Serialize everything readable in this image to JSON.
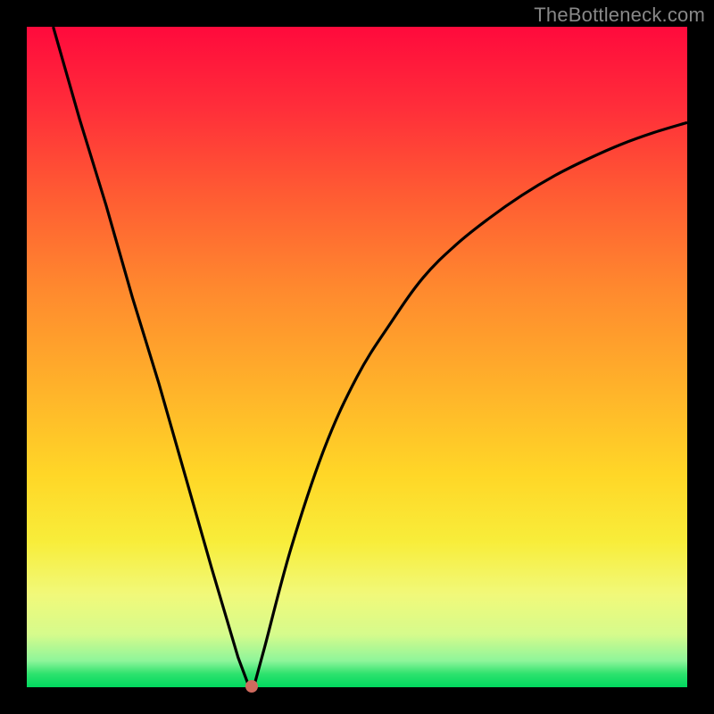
{
  "watermark": "TheBottleneck.com",
  "colors": {
    "frame": "#000000",
    "gradient_top": "#ff0a3c",
    "gradient_bottom": "#00d85f",
    "curve": "#000000",
    "dot": "#cf6a5e"
  },
  "chart_data": {
    "type": "line",
    "title": "",
    "xlabel": "",
    "ylabel": "",
    "xlim": [
      0,
      100
    ],
    "ylim": [
      0,
      100
    ],
    "series": [
      {
        "name": "left-branch",
        "x": [
          4,
          8,
          12,
          16,
          20,
          24,
          28,
          32,
          33.5
        ],
        "values": [
          100,
          86,
          73,
          59,
          46,
          32,
          18,
          4.5,
          0.5
        ]
      },
      {
        "name": "right-branch",
        "x": [
          34.5,
          36,
          40,
          45,
          50,
          55,
          60,
          65,
          70,
          75,
          80,
          85,
          90,
          95,
          100
        ],
        "values": [
          0.5,
          6,
          21,
          36,
          47,
          55,
          62,
          67,
          71,
          74.5,
          77.5,
          80,
          82.2,
          84,
          85.5
        ]
      }
    ],
    "annotations": [
      {
        "name": "minimum-dot",
        "x": 34,
        "y": 0
      }
    ]
  }
}
